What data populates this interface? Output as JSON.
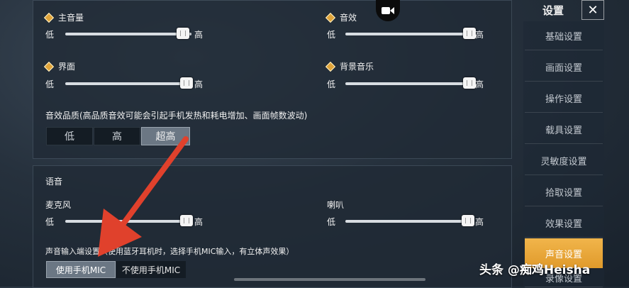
{
  "sidebar": {
    "title": "设置",
    "items": [
      {
        "label": "基础设置"
      },
      {
        "label": "画面设置"
      },
      {
        "label": "操作设置"
      },
      {
        "label": "载具设置"
      },
      {
        "label": "灵敏度设置"
      },
      {
        "label": "拾取设置"
      },
      {
        "label": "效果设置"
      },
      {
        "label": "声音设置",
        "active": true
      },
      {
        "label": "录像设置"
      }
    ]
  },
  "sliders": {
    "master": {
      "label": "主音量",
      "low": "低",
      "high": "高",
      "value": 0.93
    },
    "sfx": {
      "label": "音效",
      "low": "低",
      "high": "高",
      "value": 0.97
    },
    "ui": {
      "label": "界面",
      "low": "低",
      "high": "高",
      "value": 0.96
    },
    "bgm": {
      "label": "背景音乐",
      "low": "低",
      "high": "高",
      "value": 0.97
    },
    "mic": {
      "label": "麦克风",
      "low": "低",
      "high": "高",
      "value": 0.96
    },
    "speaker": {
      "label": "喇叭",
      "low": "低",
      "high": "高",
      "value": 0.96
    }
  },
  "quality": {
    "label": "音效品质(高品质音效可能会引起手机发热和耗电增加、画面帧数波动)",
    "options": [
      "低",
      "高",
      "超高"
    ],
    "selected": "超高"
  },
  "voice": {
    "title": "语音"
  },
  "input": {
    "label": "声音输入端设置（使用蓝牙耳机时，选择手机MIC输入，有立体声效果）",
    "use_mic": "使用手机MIC",
    "no_mic": "不使用手机MIC"
  },
  "watermark": "头条 @痴鸡Heisha",
  "colors": {
    "accent": "#e9a63a",
    "arrow": "#e0412c"
  }
}
